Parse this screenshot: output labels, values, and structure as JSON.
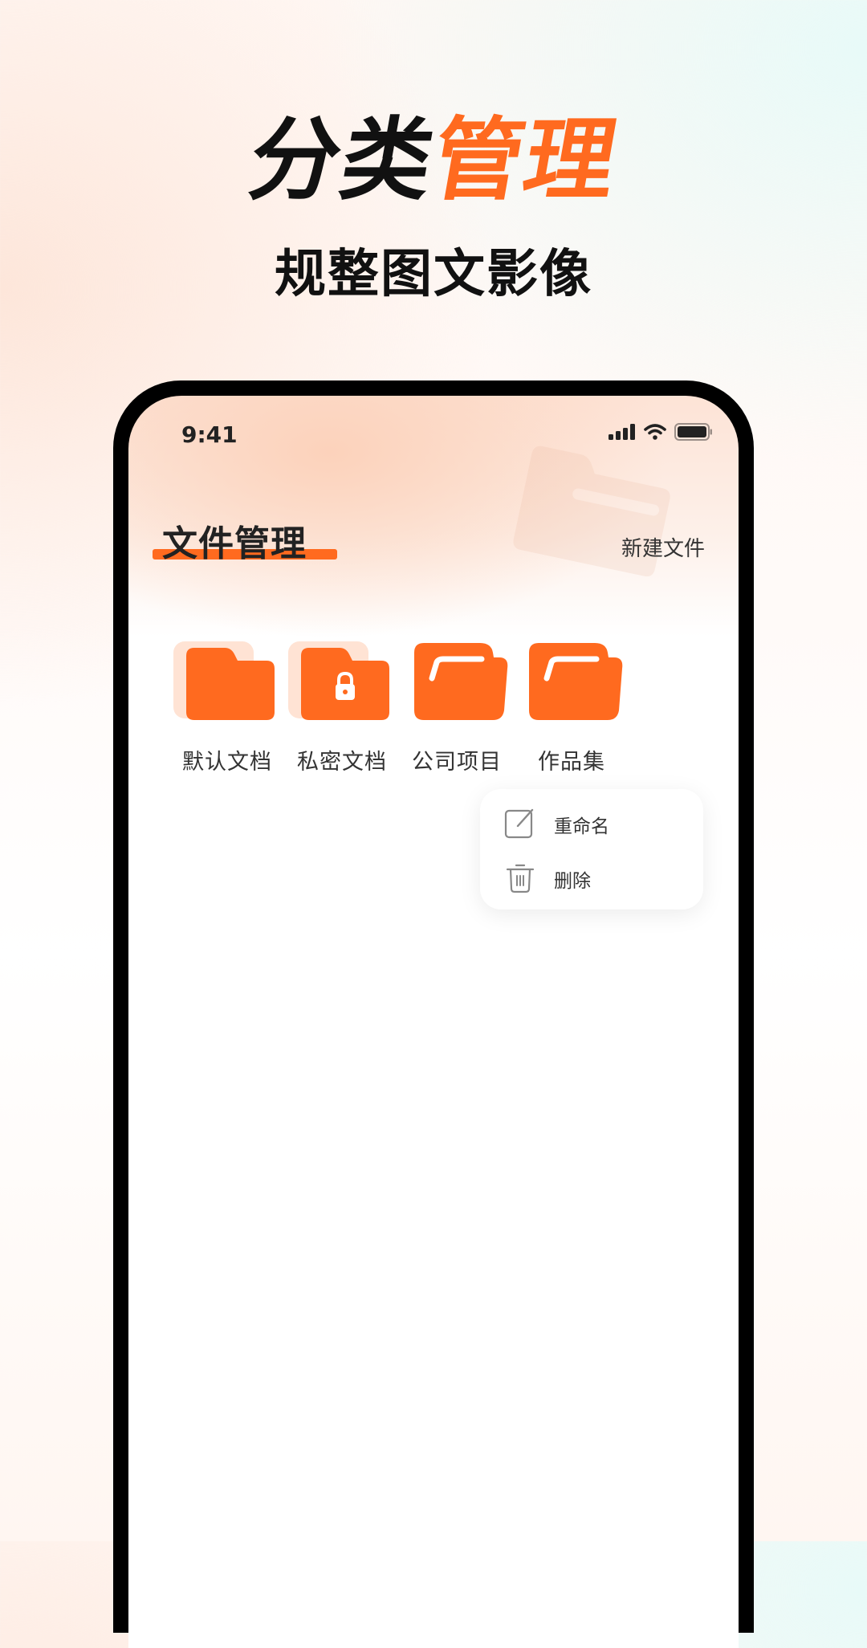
{
  "headline": {
    "part1": "分类",
    "part2": "管理",
    "subtitle": "规整图文影像"
  },
  "status_bar": {
    "time": "9:41",
    "icons": [
      "signal-icon",
      "wifi-icon",
      "battery-icon"
    ]
  },
  "header": {
    "title": "文件管理",
    "action_label": "新建文件"
  },
  "folders": [
    {
      "label": "默认文档",
      "icon": "folder-icon"
    },
    {
      "label": "私密文档",
      "icon": "locked-folder-icon"
    },
    {
      "label": "公司项目",
      "icon": "open-folder-icon"
    },
    {
      "label": "作品集",
      "icon": "open-folder-icon"
    }
  ],
  "context_menu": {
    "items": [
      {
        "label": "重命名",
        "icon": "edit-icon"
      },
      {
        "label": "删除",
        "icon": "trash-icon"
      }
    ]
  },
  "colors": {
    "accent": "#ff6a1f",
    "text_dark": "#222222"
  }
}
